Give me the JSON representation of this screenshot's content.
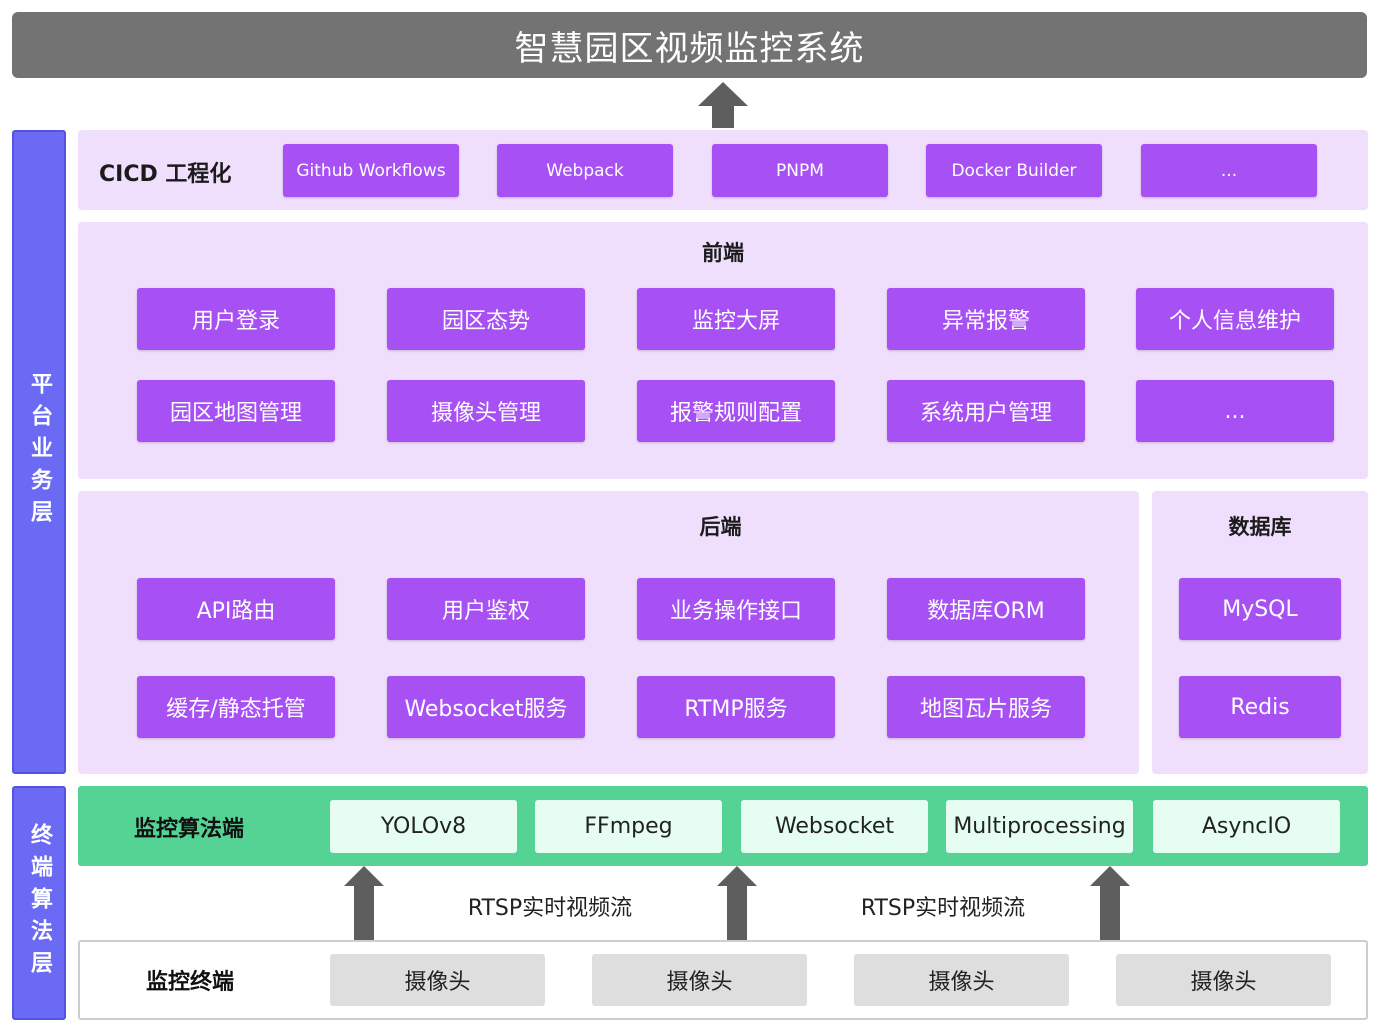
{
  "title": "智慧园区视频监控系统",
  "colors": {
    "title_bg": "#737373",
    "side_bg": "#6a6af4",
    "panel_bg": "#efdefc",
    "button": "#a751f5",
    "algo_bg": "#55d395",
    "algo_button": "#e6fdf2",
    "camera": "#dedede",
    "arrow": "#5e5e5e"
  },
  "layers": {
    "platform": "平台业务层",
    "terminal": "终端算法层"
  },
  "cicd": {
    "label": "CICD 工程化",
    "items": [
      "Github Workflows",
      "Webpack",
      "PNPM",
      "Docker Builder",
      "..."
    ]
  },
  "frontend": {
    "title": "前端",
    "items": [
      "用户登录",
      "园区态势",
      "监控大屏",
      "异常报警",
      "个人信息维护",
      "园区地图管理",
      "摄像头管理",
      "报警规则配置",
      "系统用户管理",
      "..."
    ]
  },
  "backend": {
    "title": "后端",
    "items": [
      "API路由",
      "用户鉴权",
      "业务操作接口",
      "数据库ORM",
      "缓存/静态托管",
      "Websocket服务",
      "RTMP服务",
      "地图瓦片服务"
    ]
  },
  "database": {
    "title": "数据库",
    "items": [
      "MySQL",
      "Redis"
    ]
  },
  "algorithm": {
    "label": "监控算法端",
    "items": [
      "YOLOv8",
      "FFmpeg",
      "Websocket",
      "Multiprocessing",
      "AsyncIO"
    ]
  },
  "streams": [
    "RTSP实时视频流",
    "RTSP实时视频流"
  ],
  "terminal": {
    "label": "监控终端",
    "cameras": [
      "摄像头",
      "摄像头",
      "摄像头",
      "摄像头"
    ]
  }
}
